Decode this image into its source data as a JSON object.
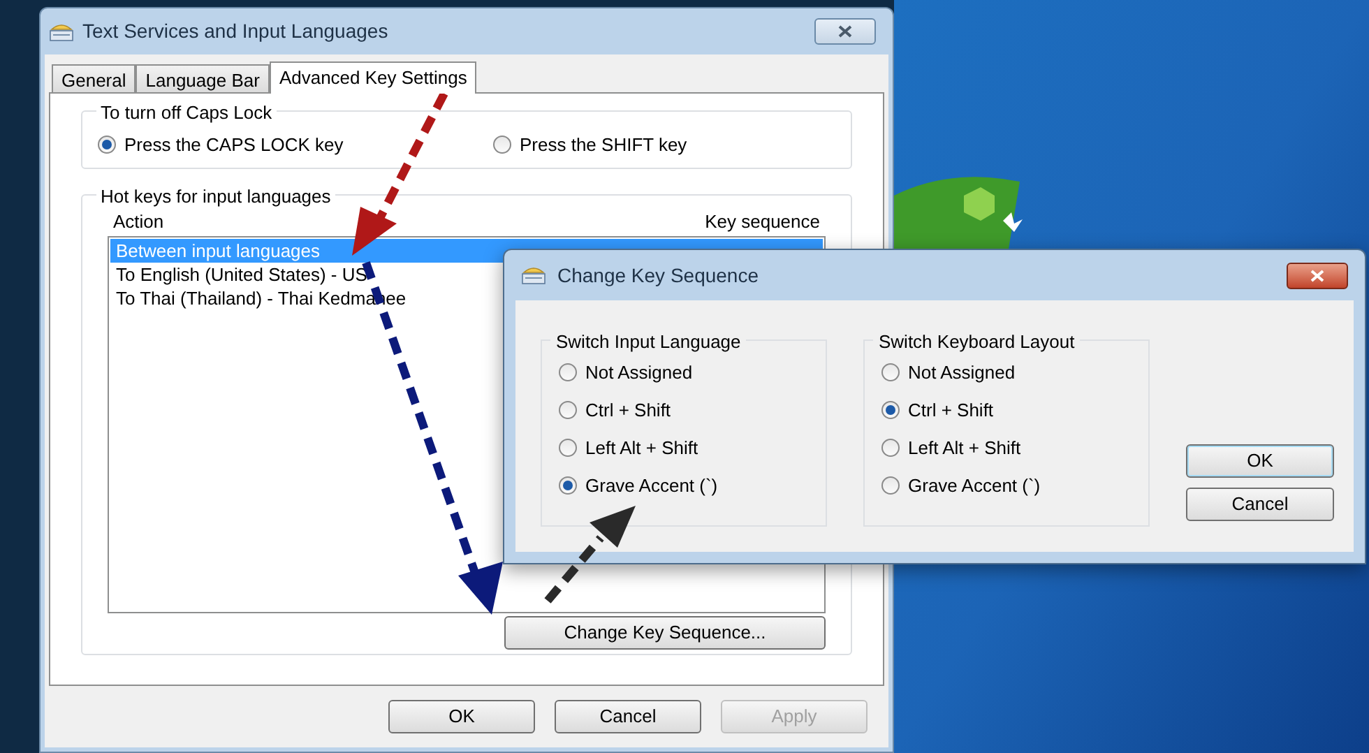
{
  "main_window": {
    "title": "Text Services and Input Languages",
    "tabs": [
      {
        "label": "General",
        "selected": false
      },
      {
        "label": "Language Bar",
        "selected": false
      },
      {
        "label": "Advanced Key Settings",
        "selected": true
      }
    ],
    "caps_lock": {
      "title": "To turn off Caps Lock",
      "options": [
        {
          "label": "Press the CAPS LOCK key",
          "selected": true
        },
        {
          "label": "Press the SHIFT key",
          "selected": false
        }
      ]
    },
    "hot_keys": {
      "title": "Hot keys for input languages",
      "columns": [
        "Action",
        "Key sequence"
      ],
      "rows": [
        {
          "action": "Between input languages",
          "selected": true
        },
        {
          "action": "To English (United States) - US",
          "selected": false
        },
        {
          "action": "To Thai (Thailand) - Thai Kedmanee",
          "selected": false
        }
      ],
      "button": "Change Key Sequence..."
    },
    "buttons": [
      {
        "label": "OK",
        "disabled": false
      },
      {
        "label": "Cancel",
        "disabled": false
      },
      {
        "label": "Apply",
        "disabled": true
      }
    ]
  },
  "dialog": {
    "title": "Change Key Sequence",
    "groups": [
      {
        "title": "Switch Input Language",
        "options": [
          {
            "label": "Not Assigned",
            "selected": false
          },
          {
            "label": "Ctrl + Shift",
            "selected": false
          },
          {
            "label": "Left Alt + Shift",
            "selected": false
          },
          {
            "label": "Grave Accent (`)",
            "selected": true
          }
        ]
      },
      {
        "title": "Switch Keyboard Layout",
        "options": [
          {
            "label": "Not Assigned",
            "selected": false
          },
          {
            "label": "Ctrl + Shift",
            "selected": true
          },
          {
            "label": "Left Alt + Shift",
            "selected": false
          },
          {
            "label": "Grave Accent (`)",
            "selected": false
          }
        ]
      }
    ],
    "buttons": [
      {
        "label": "OK",
        "default": true
      },
      {
        "label": "Cancel",
        "default": false
      }
    ]
  }
}
